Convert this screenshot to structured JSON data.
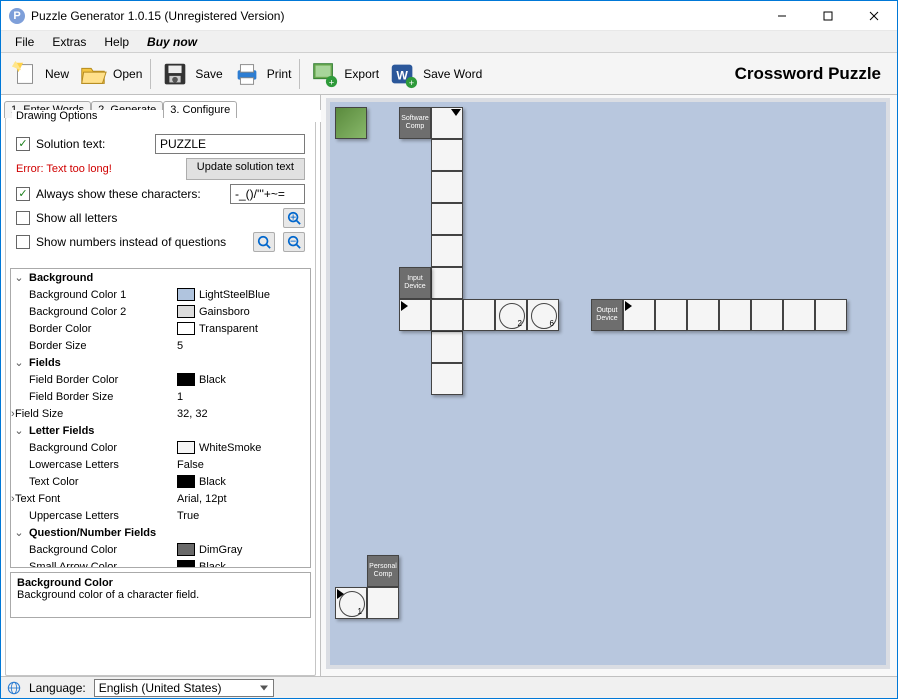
{
  "window": {
    "title": "Puzzle Generator 1.0.15 (Unregistered Version)"
  },
  "menu": {
    "file": "File",
    "extras": "Extras",
    "help": "Help",
    "buy": "Buy now"
  },
  "toolbar": {
    "new": "New",
    "open": "Open",
    "save": "Save",
    "print": "Print",
    "export": "Export",
    "saveword": "Save Word",
    "title": "Crossword Puzzle"
  },
  "tabs": {
    "t1": "1. Enter Words",
    "t2": "2. Generate",
    "t3": "3. Configure"
  },
  "panel": {
    "legend": "Drawing Options",
    "solution_label": "Solution text:",
    "solution_value": "PUZZLE",
    "error": "Error: Text too long!",
    "update_btn": "Update solution text",
    "always_label": "Always show these characters:",
    "always_value": "-_()/'''+~=",
    "showall": "Show all letters",
    "shownum": "Show numbers instead of questions"
  },
  "props": {
    "cat_background": "Background",
    "bg1_name": "Background Color 1",
    "bg1_val": "LightSteelBlue",
    "bg2_name": "Background Color 2",
    "bg2_val": "Gainsboro",
    "bcolor_name": "Border Color",
    "bcolor_val": "Transparent",
    "bsize_name": "Border Size",
    "bsize_val": "5",
    "cat_fields": "Fields",
    "fbcolor_name": "Field Border Color",
    "fbcolor_val": "Black",
    "fbsize_name": "Field Border Size",
    "fbsize_val": "1",
    "fsize_name": "Field Size",
    "fsize_val": "32, 32",
    "cat_letter": "Letter Fields",
    "lbg_name": "Background Color",
    "lbg_val": "WhiteSmoke",
    "llow_name": "Lowercase Letters",
    "llow_val": "False",
    "ltcol_name": "Text Color",
    "ltcol_val": "Black",
    "lfont_name": "Text Font",
    "lfont_val": "Arial, 12pt",
    "lupp_name": "Uppercase Letters",
    "lupp_val": "True",
    "cat_qn": "Question/Number Fields",
    "qbg_name": "Background Color",
    "qbg_val": "DimGray",
    "qac_name": "Small Arrow Color",
    "qac_val": "Black"
  },
  "propdesc": {
    "name": "Background Color",
    "text": "Background color of a character field."
  },
  "canvas": {
    "clue1": "Software Comp",
    "clue2": "Input Device",
    "clue3": "Output Device",
    "clue4": "Personal Comp",
    "c2": "2",
    "c6": "6",
    "c1": "1"
  },
  "status": {
    "lang_label": "Language:",
    "lang_value": "English (United States)"
  }
}
